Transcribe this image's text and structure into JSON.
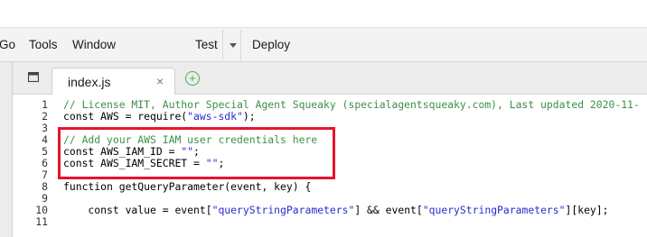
{
  "menu": {
    "items": [
      "Go",
      "Tools",
      "Window"
    ],
    "run_config": "Test",
    "deploy": "Deploy"
  },
  "tabs": {
    "active_file": "index.js",
    "close_glyph": "×",
    "add_glyph": "+"
  },
  "editor": {
    "lines": [
      {
        "n": "1",
        "tokens": [
          {
            "t": "// License MIT, Author Special Agent Squeaky (specialagentsqueaky.com), Last updated 2020-11-",
            "c": "c-comment"
          }
        ]
      },
      {
        "n": "2",
        "tokens": [
          {
            "t": "const AWS = require(",
            "c": "c-plain"
          },
          {
            "t": "\"aws-sdk\"",
            "c": "c-str"
          },
          {
            "t": ");",
            "c": "c-plain"
          }
        ]
      },
      {
        "n": "3",
        "tokens": []
      },
      {
        "n": "4",
        "tokens": [
          {
            "t": "// Add your AWS IAM user credentials here",
            "c": "c-comment"
          }
        ]
      },
      {
        "n": "5",
        "tokens": [
          {
            "t": "const AWS_IAM_ID = ",
            "c": "c-plain"
          },
          {
            "t": "\"\"",
            "c": "c-str"
          },
          {
            "t": ";",
            "c": "c-plain"
          }
        ]
      },
      {
        "n": "6",
        "tokens": [
          {
            "t": "const AWS_IAM_SECRET = ",
            "c": "c-plain"
          },
          {
            "t": "\"\"",
            "c": "c-str"
          },
          {
            "t": ";",
            "c": "c-plain"
          }
        ]
      },
      {
        "n": "7",
        "tokens": []
      },
      {
        "n": "8",
        "tokens": [
          {
            "t": "function getQueryParameter(event, key) {",
            "c": "c-plain"
          }
        ]
      },
      {
        "n": "9",
        "tokens": []
      },
      {
        "n": "10",
        "tokens": [
          {
            "t": "    const value = event[",
            "c": "c-plain"
          },
          {
            "t": "\"queryStringParameters\"",
            "c": "c-str"
          },
          {
            "t": "] && event[",
            "c": "c-plain"
          },
          {
            "t": "\"queryStringParameters\"",
            "c": "c-str"
          },
          {
            "t": "][key];",
            "c": "c-plain"
          }
        ]
      },
      {
        "n": "11",
        "tokens": []
      }
    ]
  },
  "colors": {
    "highlight": "#e8132b",
    "comment": "#3e8f49",
    "string": "#2b2bcf",
    "add_icon": "#4caf50"
  }
}
